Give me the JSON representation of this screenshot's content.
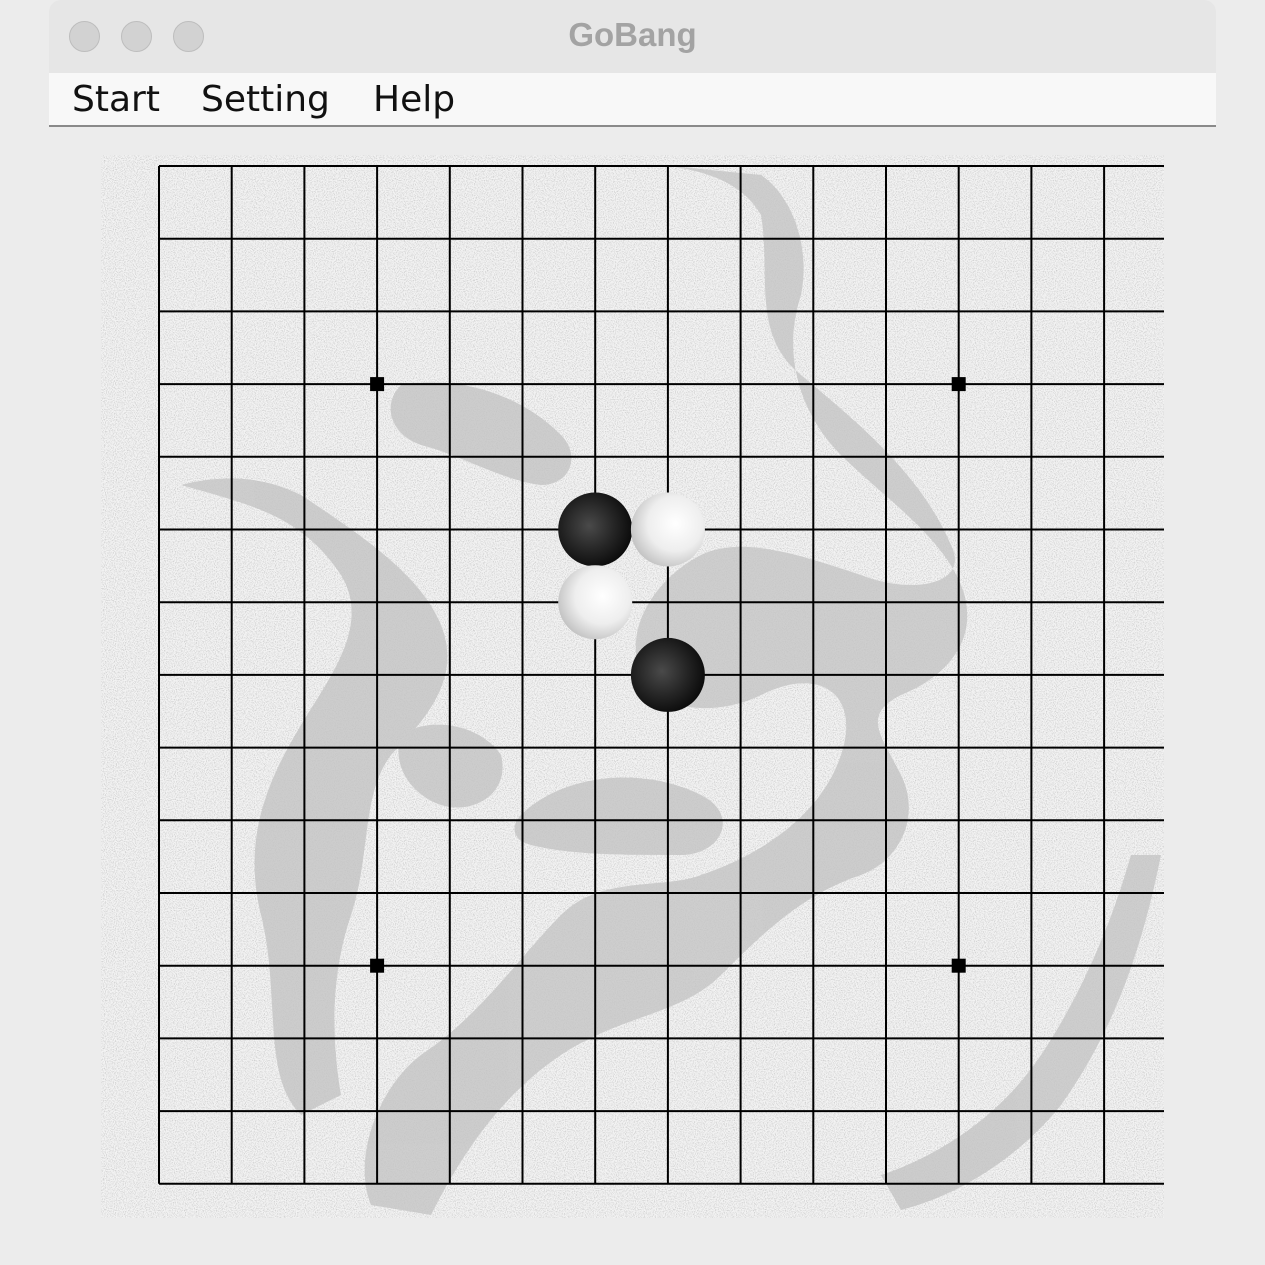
{
  "window": {
    "title": "GoBang",
    "traffic_lights": [
      "close",
      "minimize",
      "zoom"
    ]
  },
  "menu": {
    "items": [
      {
        "id": "start",
        "label": "Start"
      },
      {
        "id": "setting",
        "label": "Setting"
      },
      {
        "id": "help",
        "label": "Help"
      }
    ]
  },
  "board": {
    "size": 15,
    "star_points": [
      [
        3,
        3
      ],
      [
        11,
        3
      ],
      [
        3,
        11
      ],
      [
        11,
        11
      ]
    ],
    "stones": [
      {
        "col": 6,
        "row": 5,
        "color": "black"
      },
      {
        "col": 7,
        "row": 5,
        "color": "white"
      },
      {
        "col": 6,
        "row": 6,
        "color": "white"
      },
      {
        "col": 7,
        "row": 7,
        "color": "black"
      }
    ]
  },
  "colors": {
    "grid_line": "#000000",
    "black_stone": "#1a1a1a",
    "white_stone": "#f5f5f5"
  }
}
